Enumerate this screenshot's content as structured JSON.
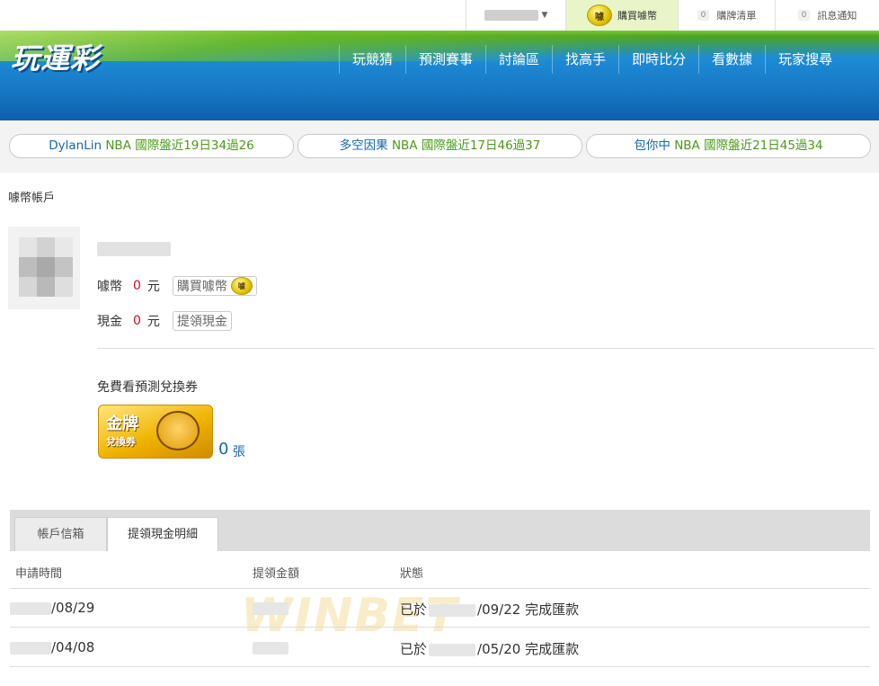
{
  "topbar": {
    "buy_label": "購買噱幣",
    "coin_glyph": "噱",
    "cart_count": "0",
    "cart_label": "購牌清單",
    "msg_count": "0",
    "msg_label": "訊息通知"
  },
  "header": {
    "logo": "玩運彩",
    "nav": [
      "玩競猜",
      "預測賽事",
      "討論區",
      "找高手",
      "即時比分",
      "看數據",
      "玩家搜尋"
    ]
  },
  "ticker": [
    {
      "name": "DylanLin",
      "info": "NBA 國際盤近19日34過26"
    },
    {
      "name": "多空因果",
      "info": "NBA 國際盤近17日46過37"
    },
    {
      "name": "包你中",
      "info": "NBA 國際盤近21日45過34"
    }
  ],
  "account": {
    "title": "噱幣帳戶",
    "coin_label": "噱幣",
    "coin_value": "0",
    "coin_unit": "元",
    "buy_button": "購買噱幣",
    "cash_label": "現金",
    "cash_value": "0",
    "cash_unit": "元",
    "withdraw_button": "提領現金"
  },
  "voucher": {
    "title": "免費看預測兌換券",
    "badge_line1": "金牌",
    "badge_line2": "兌換券",
    "count": "0",
    "unit": "張"
  },
  "tabs": [
    {
      "label": "帳戶信箱",
      "active": false
    },
    {
      "label": "提領現金明細",
      "active": true
    }
  ],
  "table": {
    "headers": [
      "申請時間",
      "提領金額",
      "狀態"
    ],
    "rows": [
      {
        "date": "/08/29",
        "status_prefix": "已於",
        "status_date": "/09/22",
        "status_text": "完成匯款"
      },
      {
        "date": "/04/08",
        "status_prefix": "已於",
        "status_date": "/05/20",
        "status_text": "完成匯款"
      }
    ]
  },
  "watermark": "WINBET",
  "colors": {
    "accent_blue": "#1576c4",
    "accent_green": "#4c9a1a",
    "value_red": "#c8102e"
  }
}
